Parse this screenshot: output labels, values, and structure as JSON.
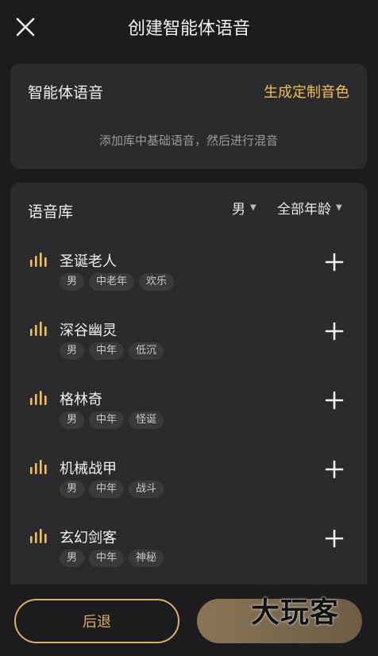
{
  "header": {
    "title": "创建智能体语音"
  },
  "agent_voice": {
    "title": "智能体语音",
    "generate_link": "生成定制音色",
    "hint": "添加库中基础语音，然后进行混音"
  },
  "library": {
    "title": "语音库",
    "gender_filter": "男",
    "age_filter": "全部年龄",
    "items": [
      {
        "name": "圣诞老人",
        "tags": [
          "男",
          "中老年",
          "欢乐"
        ]
      },
      {
        "name": "深谷幽灵",
        "tags": [
          "男",
          "中年",
          "低沉"
        ]
      },
      {
        "name": "格林奇",
        "tags": [
          "男",
          "中年",
          "怪诞"
        ]
      },
      {
        "name": "机械战甲",
        "tags": [
          "男",
          "中年",
          "战斗"
        ]
      },
      {
        "name": "玄幻剑客",
        "tags": [
          "男",
          "中年",
          "神秘"
        ]
      }
    ]
  },
  "footer": {
    "back_label": "后退",
    "watermark": "大玩客"
  },
  "colors": {
    "accent": "#f0bf57",
    "card": "#2b2b2d",
    "background": "#1c1c1e"
  }
}
